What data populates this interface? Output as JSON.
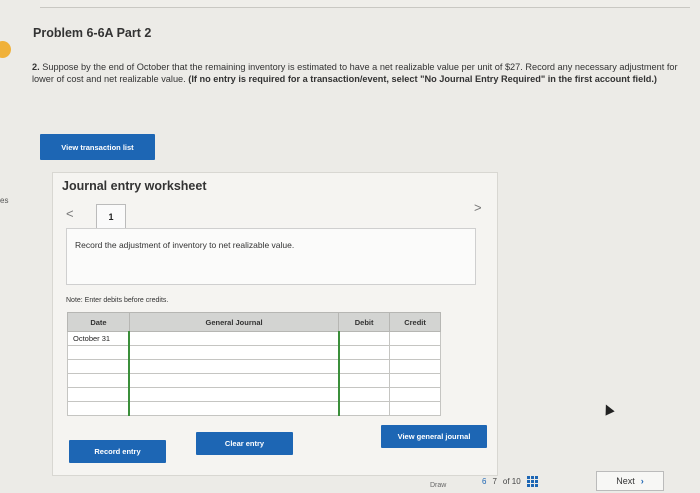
{
  "side_text": "es",
  "problem": {
    "title": "Problem 6-6A Part 2",
    "number": "2.",
    "question": "Suppose by the end of October that the remaining inventory is estimated to have a net realizable value per unit of $27. Record any necessary adjustment for lower of cost and net realizable value.",
    "instruction": "(If no entry is required for a transaction/event, select \"No Journal Entry Required\" in the first account field.)"
  },
  "buttons": {
    "view_transaction_list": "View transaction list",
    "record_entry": "Record entry",
    "clear_entry": "Clear entry",
    "view_general_journal": "View general journal"
  },
  "worksheet": {
    "title": "Journal entry worksheet",
    "page": "1",
    "prev_glyph": "<",
    "next_glyph": ">",
    "record_text": "Record the adjustment of inventory to net realizable value.",
    "note": "Note: Enter debits before credits."
  },
  "table": {
    "headers": {
      "date": "Date",
      "account": "General Journal",
      "debit": "Debit",
      "credit": "Credit"
    },
    "rows": [
      {
        "date": "October 31"
      },
      {
        "date": ""
      },
      {
        "date": ""
      },
      {
        "date": ""
      },
      {
        "date": ""
      },
      {
        "date": ""
      }
    ]
  },
  "footer": {
    "draw_label": "Draw",
    "page_prev": "6",
    "page_current": "7",
    "of_total": "of 10",
    "next_label": "Next"
  },
  "colors": {
    "accent": "#1d66b4",
    "active_border": "#3b8f3b",
    "badge": "#f0b13a"
  }
}
